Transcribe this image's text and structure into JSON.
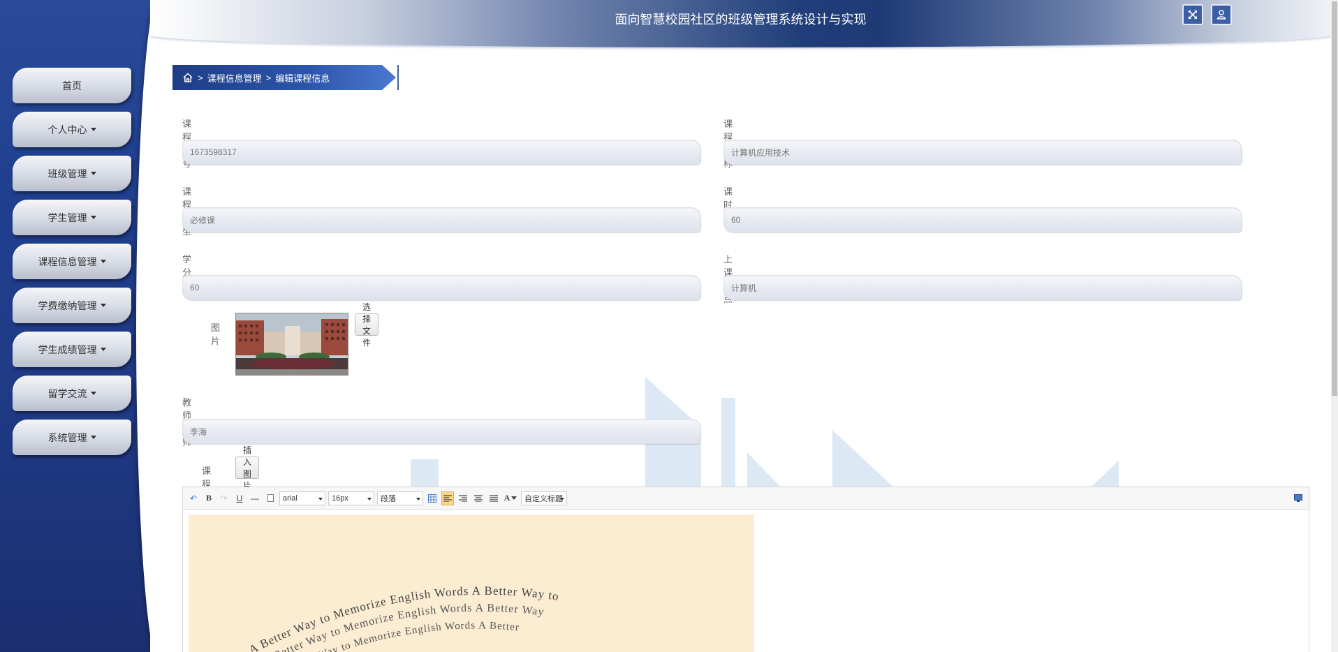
{
  "header": {
    "title": "面向智慧校园社区的班级管理系统设计与实现",
    "fullscreen_icon": "fullscreen-icon",
    "user_icon": "user-icon"
  },
  "sidebar": {
    "items": [
      {
        "label": "首页",
        "dropdown": false
      },
      {
        "label": "个人中心",
        "dropdown": true
      },
      {
        "label": "班级管理",
        "dropdown": true
      },
      {
        "label": "学生管理",
        "dropdown": true
      },
      {
        "label": "课程信息管理",
        "dropdown": true
      },
      {
        "label": "学费缴纳管理",
        "dropdown": true
      },
      {
        "label": "学生成绩管理",
        "dropdown": true
      },
      {
        "label": "留学交流",
        "dropdown": true
      },
      {
        "label": "系统管理",
        "dropdown": true
      }
    ]
  },
  "breadcrumb": {
    "home_icon": "home-icon",
    "sep": ">",
    "level1": "课程信息管理",
    "level2": "编辑课程信息"
  },
  "form": {
    "course_no": {
      "label": "课程编号",
      "value": "1673598317"
    },
    "course_name": {
      "label": "课程名称",
      "value": "计算机应用技术"
    },
    "course_type": {
      "label": "课程类型",
      "value": "必修课"
    },
    "hours": {
      "label": "课时",
      "value": "60"
    },
    "credits": {
      "label": "学分",
      "value": "60"
    },
    "location": {
      "label": "上课地点",
      "value": "计算机"
    },
    "picture": {
      "label": "图片",
      "button": "选择文件"
    },
    "teacher": {
      "label": "教师讲师",
      "value": "李海"
    },
    "schedule": {
      "label": "课程表",
      "button": "插入图片"
    }
  },
  "editor": {
    "font": "arial",
    "size": "16px",
    "paragraph": "段落",
    "custom_title": "自定义标题",
    "image_text_lines": [
      "A Better Way to Memorize English Words A Better Way to",
      "A Better Way to Memorize English Words A Better Way",
      "A Better Way to Memorize English Words A Better"
    ]
  },
  "colors": {
    "sidebar": "#203a86",
    "accent": "#2c55a8",
    "highlight": "#fcd587"
  }
}
